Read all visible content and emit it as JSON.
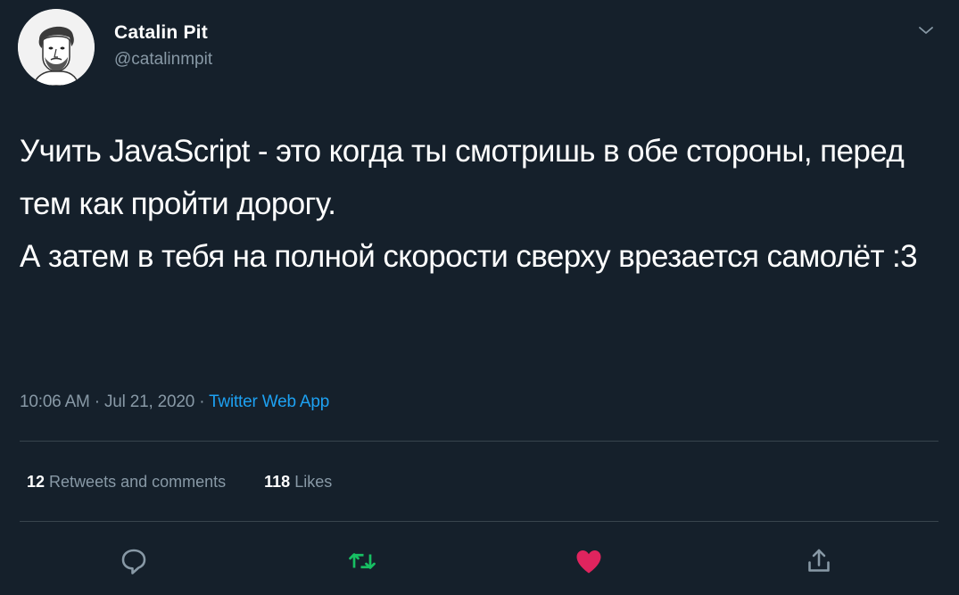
{
  "user": {
    "display_name": "Catalin Pit",
    "handle": "@catalinmpit"
  },
  "tweet": {
    "lines": [
      "Учить JavaScript - это когда ты смотришь в обе стороны, перед тем как пройти дорогу.",
      "А затем в тебя на полной скорости сверху врезается самолёт :3"
    ]
  },
  "meta": {
    "time": "10:06 AM",
    "separator": " · ",
    "date": "Jul 21, 2020",
    "source": "Twitter Web App"
  },
  "stats": {
    "retweets_count": "12",
    "retweets_label": "Retweets and comments",
    "likes_count": "118",
    "likes_label": "Likes"
  },
  "actions": {
    "reply_icon": "reply-icon",
    "retweet_icon": "retweet-icon",
    "like_icon": "heart-icon",
    "share_icon": "share-icon"
  },
  "colors": {
    "background": "#15202b",
    "text": "#ffffff",
    "secondary": "#8899a6",
    "link": "#1da1f2",
    "retweet": "#17bf63",
    "like": "#e0245e",
    "divider": "#38444d"
  }
}
